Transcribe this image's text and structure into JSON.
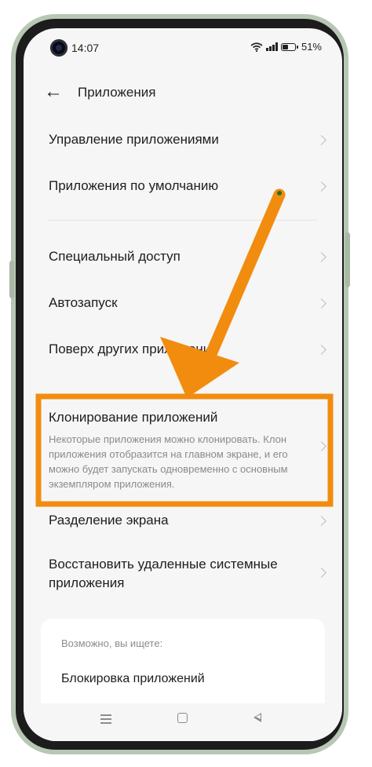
{
  "status_bar": {
    "time": "14:07",
    "battery": "51%",
    "battery_level": 0.51
  },
  "header": {
    "title": "Приложения"
  },
  "items": [
    {
      "label": "Управление приложениями"
    },
    {
      "label": "Приложения по умолчанию"
    },
    {
      "label": "Специальный доступ"
    },
    {
      "label": "Автозапуск"
    },
    {
      "label": "Поверх других приложений"
    },
    {
      "label": "Клонирование приложений",
      "description": "Некоторые приложения можно клонировать. Клон приложения отобразится на главном экране, и его можно будет запускать одновременно с основным экземпляром приложения."
    },
    {
      "label": "Разделение экрана"
    },
    {
      "label": "Восстановить удаленные системные приложения"
    }
  ],
  "suggestions": {
    "heading": "Возможно, вы ищете:",
    "items": [
      "Блокировка приложений"
    ]
  },
  "icons": {
    "back": "arrow-left-icon",
    "chevron": "chevron-right-icon",
    "wifi": "wifi-icon",
    "signal": "signal-icon",
    "battery": "battery-icon",
    "nav_menu": "menu-icon",
    "nav_home": "home-icon",
    "nav_back": "back-triangle-icon"
  },
  "colors": {
    "highlight": "#f28c0f",
    "background": "#f6f6f6",
    "text": "#1d1d1d",
    "secondary_text": "#8a8a8a"
  }
}
